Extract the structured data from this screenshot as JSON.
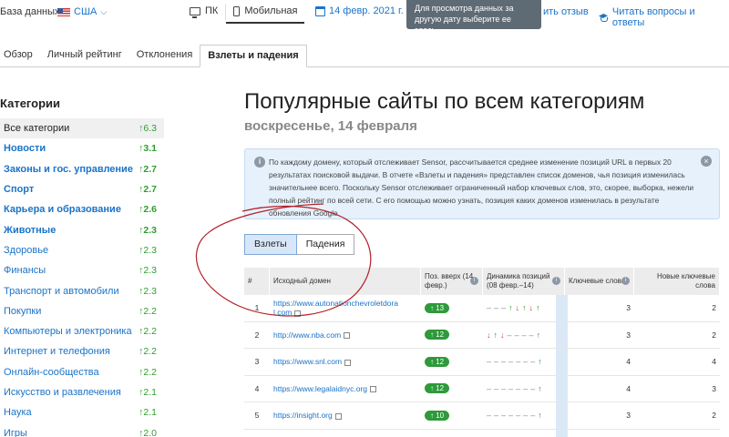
{
  "topbar": {
    "db_label": "База данных:",
    "db_value": "США",
    "devices": [
      "ПК",
      "Мобильная"
    ],
    "date": "14 февр. 2021 г.",
    "tooltip": "Для просмотра данных за другую дату выберите ее здесь.",
    "feedback": "ить отзыв",
    "questions": "Читать вопросы и ответы"
  },
  "tabs": [
    "Обзор",
    "Личный рейтинг",
    "Отклонения",
    "Взлеты и падения"
  ],
  "sidebar": {
    "title": "Категории",
    "items": [
      {
        "name": "Все категории",
        "value": "↑6.3"
      },
      {
        "name": "Новости",
        "value": "↑3.1"
      },
      {
        "name": "Законы и гос. управление",
        "value": "↑2.7"
      },
      {
        "name": "Спорт",
        "value": "↑2.7"
      },
      {
        "name": "Карьера и образование",
        "value": "↑2.6"
      },
      {
        "name": "Животные",
        "value": "↑2.3"
      },
      {
        "name": "Здоровье",
        "value": "↑2.3"
      },
      {
        "name": "Финансы",
        "value": "↑2.3"
      },
      {
        "name": "Транспорт и автомобили",
        "value": "↑2.3"
      },
      {
        "name": "Покупки",
        "value": "↑2.2"
      },
      {
        "name": "Компьютеры и электроника",
        "value": "↑2.2"
      },
      {
        "name": "Интернет и телефония",
        "value": "↑2.2"
      },
      {
        "name": "Онлайн-сообщества",
        "value": "↑2.2"
      },
      {
        "name": "Искусство и развлечения",
        "value": "↑2.1"
      },
      {
        "name": "Наука",
        "value": "↑2.1"
      },
      {
        "name": "Игры",
        "value": "↑2.0"
      }
    ]
  },
  "main": {
    "title": "Популярные сайты по всем категориям",
    "subtitle": "воскресенье, 14 февраля",
    "info": "По каждому домену, который отслеживает Sensor, рассчитывается среднее изменение позиций URL в первых 20 результатах поисковой выдачи. В отчете «Взлеты и падения» представлен список доменов, чья позиция изменилась значительнее всего. Поскольку Sensor отслеживает ограниченный набор ключевых слов, это, скорее, выборка, нежели полный рейтинг по всей сети. С его помощью можно узнать, позиция каких доменов изменилась в результате обновления Google.",
    "toggle": [
      "Взлеты",
      "Падения"
    ]
  },
  "table": {
    "headers": {
      "num": "#",
      "domain": "Исходный домен",
      "pos": "Поз. вверх (14 февр.)",
      "dyn": "Динамика позиций (08 февр.–14)",
      "kw": "Ключевые слова",
      "nkw": "Новые ключевые слова"
    },
    "rows": [
      {
        "num": "1",
        "domain": "https://www.autonationchevroletdora",
        "domain2": "l.com",
        "pos": "↑ 13",
        "dyn": [
          "–",
          "–",
          "–",
          "↑",
          "↓",
          "↑",
          "↓",
          "↑"
        ],
        "kw": "3",
        "nkw": "2"
      },
      {
        "num": "2",
        "domain": "http://www.nba.com",
        "domain2": "",
        "pos": "↑ 12",
        "dyn": [
          "↓",
          "↑",
          "↓",
          "–",
          "–",
          "–",
          "–",
          "↑"
        ],
        "kw": "3",
        "nkw": "2"
      },
      {
        "num": "3",
        "domain": "https://www.snl.com",
        "domain2": "",
        "pos": "↑ 12",
        "dyn": [
          "–",
          "–",
          "–",
          "–",
          "–",
          "–",
          "–",
          "↑"
        ],
        "kw": "4",
        "nkw": "4"
      },
      {
        "num": "4",
        "domain": "https://www.legalaidnyc.org",
        "domain2": "",
        "pos": "↑ 12",
        "dyn": [
          "–",
          "–",
          "–",
          "–",
          "–",
          "–",
          "–",
          "↑"
        ],
        "kw": "4",
        "nkw": "3"
      },
      {
        "num": "5",
        "domain": "https://insight.org",
        "domain2": "",
        "pos": "↑ 10",
        "dyn": [
          "–",
          "–",
          "–",
          "–",
          "–",
          "–",
          "–",
          "↑"
        ],
        "kw": "3",
        "nkw": "2"
      }
    ]
  }
}
